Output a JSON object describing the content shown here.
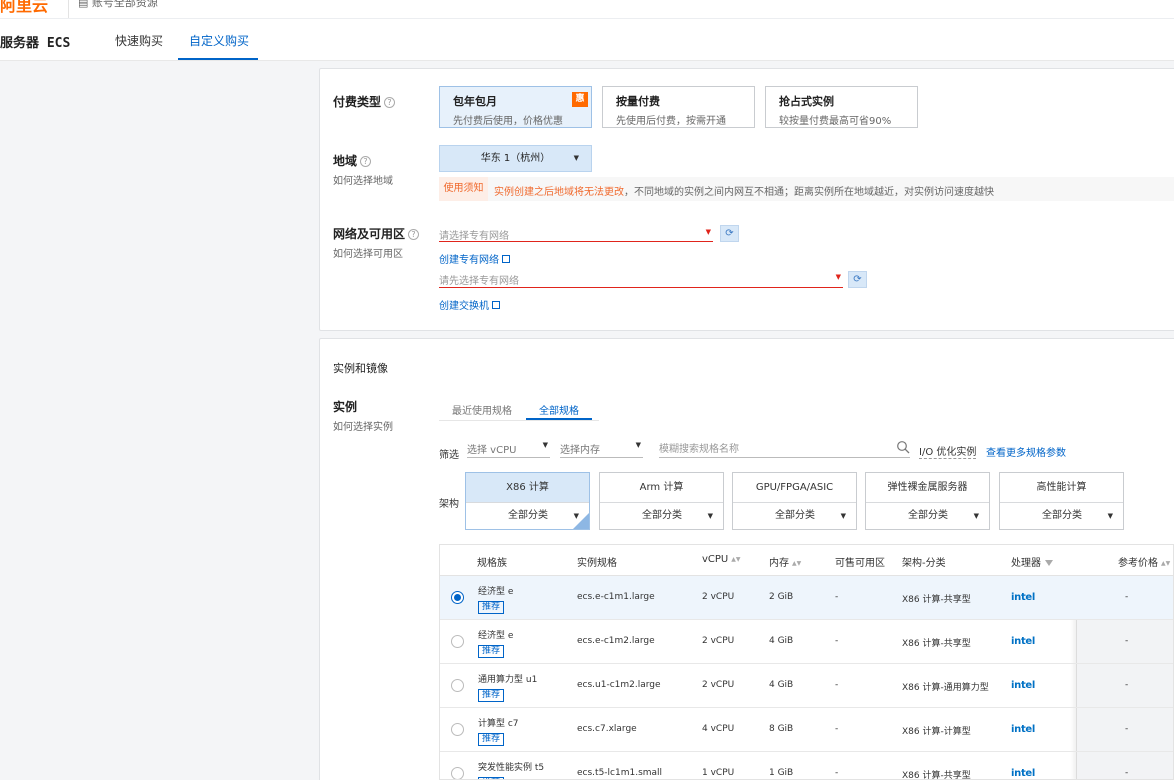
{
  "header": {
    "logo_text": "阿里云",
    "nav_link": "账号全部资源"
  },
  "product": {
    "title": "服务器 ECS",
    "tabs": [
      {
        "label": "快速购买",
        "active": false
      },
      {
        "label": "自定义购买",
        "active": true
      }
    ]
  },
  "billing": {
    "label": "付费类型",
    "options": [
      {
        "title": "包年包月",
        "desc": "先付费后使用，价格优惠",
        "badge": "惠",
        "selected": true
      },
      {
        "title": "按量付费",
        "desc": "先使用后付费，按需开通",
        "selected": false
      },
      {
        "title": "抢占式实例",
        "desc": "较按量付费最高可省90%",
        "selected": false
      }
    ]
  },
  "region": {
    "label": "地域",
    "help_link": "如何选择地域",
    "selected": "华东 1（杭州）",
    "notice_tag": "使用须知",
    "notice_warning": "实例创建之后地域将无法更改",
    "notice_text": "，不同地域的实例之间内网互不相通；距离实例所在地域越近，对实例访问速度越快"
  },
  "network": {
    "label": "网络及可用区",
    "help_link": "如何选择可用区",
    "vpc_placeholder": "请选择专有网络",
    "create_vpc": "创建专有网络",
    "vswitch_placeholder": "请先选择专有网络",
    "create_vswitch": "创建交换机"
  },
  "instance_section": {
    "title": "实例和镜像",
    "label": "实例",
    "help_link": "如何选择实例",
    "tabs": [
      {
        "label": "最近使用规格",
        "active": false
      },
      {
        "label": "全部规格",
        "active": true
      }
    ],
    "filter_label": "筛选",
    "vcpu_placeholder": "选择 vCPU",
    "memory_placeholder": "选择内存",
    "search_placeholder": "模糊搜索规格名称",
    "io_label": "I/O 优化实例",
    "more_params": "查看更多规格参数",
    "arch_label": "架构",
    "architectures": [
      {
        "name": "X86 计算",
        "category": "全部分类",
        "selected": true
      },
      {
        "name": "Arm 计算",
        "category": "全部分类",
        "selected": false
      },
      {
        "name": "GPU/FPGA/ASIC",
        "category": "全部分类",
        "selected": false
      },
      {
        "name": "弹性裸金属服务器",
        "category": "全部分类",
        "selected": false
      },
      {
        "name": "高性能计算",
        "category": "全部分类",
        "selected": false
      }
    ]
  },
  "table": {
    "headers": [
      "规格族",
      "实例规格",
      "vCPU",
      "内存",
      "可售可用区",
      "架构-分类",
      "处理器",
      "参考价格"
    ],
    "rec_label": "推荐",
    "rows": [
      {
        "family": "经济型 e",
        "spec": "ecs.e-c1m1.large",
        "vcpu": "2 vCPU",
        "memory": "2 GiB",
        "zone": "-",
        "arch": "X86 计算-共享型",
        "cpu": "intel",
        "price": "-",
        "selected": true
      },
      {
        "family": "经济型 e",
        "spec": "ecs.e-c1m2.large",
        "vcpu": "2 vCPU",
        "memory": "4 GiB",
        "zone": "-",
        "arch": "X86 计算-共享型",
        "cpu": "intel",
        "price": "-",
        "selected": false
      },
      {
        "family": "通用算力型 u1",
        "spec": "ecs.u1-c1m2.large",
        "vcpu": "2 vCPU",
        "memory": "4 GiB",
        "zone": "-",
        "arch": "X86 计算-通用算力型",
        "cpu": "intel",
        "price": "-",
        "selected": false
      },
      {
        "family": "计算型 c7",
        "spec": "ecs.c7.xlarge",
        "vcpu": "4 vCPU",
        "memory": "8 GiB",
        "zone": "-",
        "arch": "X86 计算-计算型",
        "cpu": "intel",
        "price": "-",
        "selected": false
      },
      {
        "family": "突发性能实例 t5",
        "spec": "ecs.t5-lc1m1.small",
        "vcpu": "1 vCPU",
        "memory": "1 GiB",
        "zone": "-",
        "arch": "X86 计算-共享型",
        "cpu": "intel",
        "price": "-",
        "selected": false
      }
    ]
  },
  "colors": {
    "brand": "#ff6a00",
    "accent": "#0064c8",
    "error_line": "#e0241b",
    "selected_bg": "#d8e8f8"
  }
}
